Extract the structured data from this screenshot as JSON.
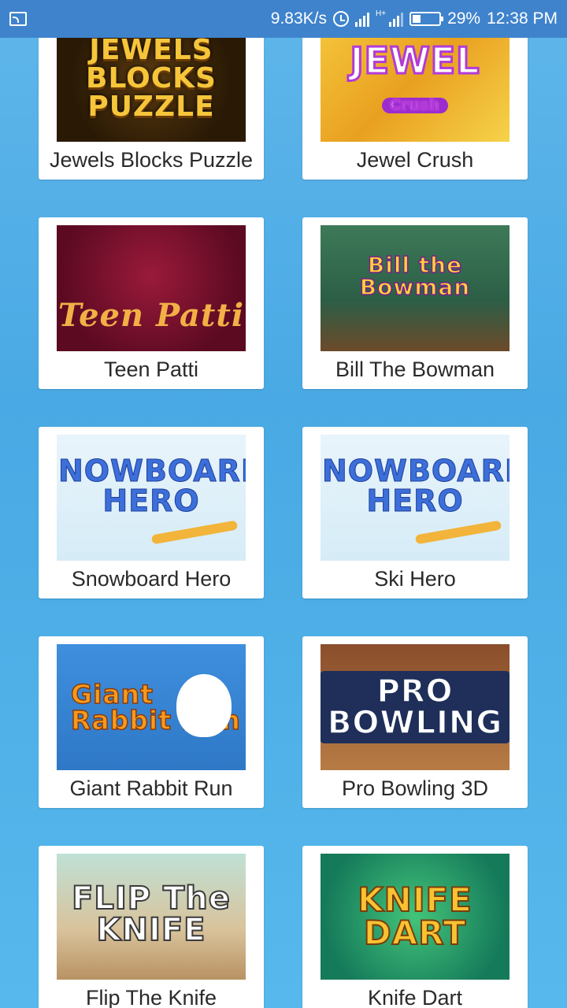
{
  "status_bar": {
    "speed": "9.83K/s",
    "network": "H+",
    "battery": "29%",
    "time": "12:38 PM"
  },
  "games": [
    {
      "label": "Jewels Blocks Puzzle",
      "thumb_text": "JEWELS BLOCKS PUZZLE"
    },
    {
      "label": "Jewel Crush",
      "thumb_text": "JEWEL",
      "thumb_sub": "Crush"
    },
    {
      "label": "Teen Patti",
      "thumb_text": "Teen Patti"
    },
    {
      "label": "Bill The Bowman",
      "thumb_text": "Bill the Bowman"
    },
    {
      "label": "Snowboard Hero",
      "thumb_text": "SNOWBOARD HERO"
    },
    {
      "label": "Ski Hero",
      "thumb_text": "SNOWBOARD HERO"
    },
    {
      "label": "Giant Rabbit Run",
      "thumb_text": "Giant Rabbit Run"
    },
    {
      "label": "Pro Bowling 3D",
      "thumb_text": "PRO BOWLING"
    },
    {
      "label": "Flip The Knife",
      "thumb_text": "FLIP The KNIFE"
    },
    {
      "label": "Knife Dart",
      "thumb_text": "KNIFE DART"
    }
  ]
}
